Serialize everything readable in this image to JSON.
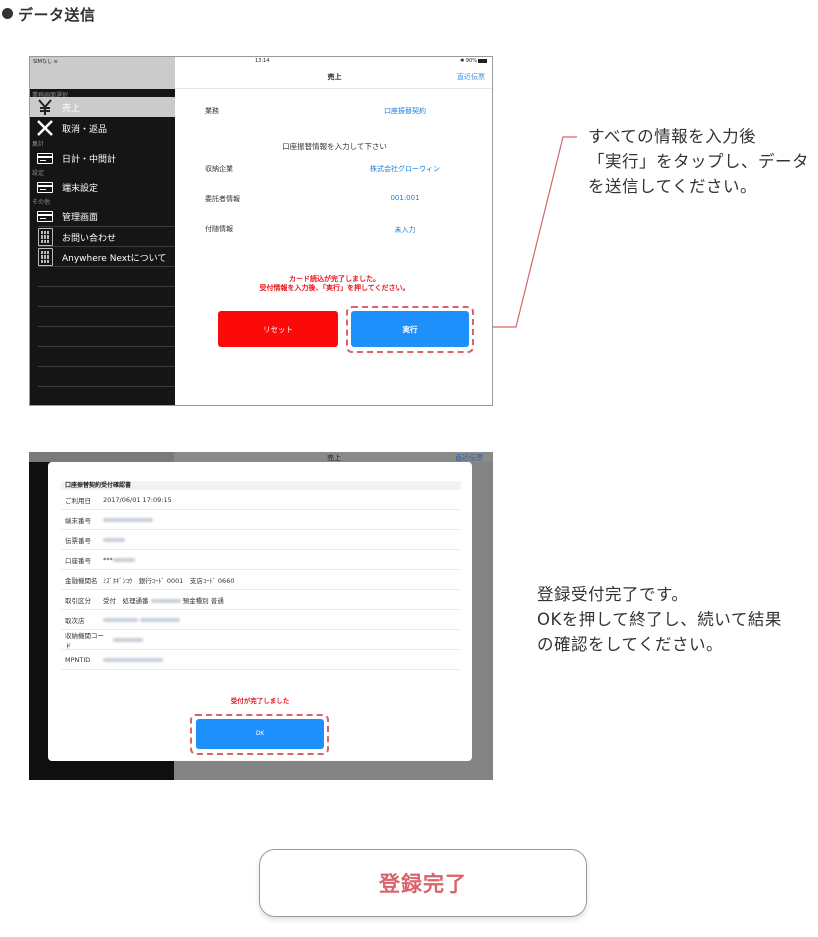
{
  "section_title": "データ送信",
  "screen1": {
    "statusbar": {
      "carrier": "SIMなし",
      "time": "13:14",
      "battery": "90%"
    },
    "sidebar": {
      "groups": [
        "業務画面選択",
        "集計",
        "設定",
        "その他"
      ],
      "items": [
        {
          "label": "売上",
          "icon": "yen-icon",
          "selected": true
        },
        {
          "label": "取消・返品",
          "icon": "x-icon",
          "selected": false
        },
        {
          "label": "日計・中間計",
          "icon": "card-icon",
          "selected": false
        },
        {
          "label": "端末設定",
          "icon": "card-icon",
          "selected": false
        },
        {
          "label": "管理画面",
          "icon": "card-icon",
          "selected": false
        },
        {
          "label": "お問い合わせ",
          "icon": "calculator-icon",
          "selected": false
        },
        {
          "label": "Anywhere Nextについて",
          "icon": "calculator-icon",
          "selected": false
        }
      ]
    },
    "navbar": {
      "title": "売上",
      "right_link": "直近伝票"
    },
    "form": {
      "business_label": "業務",
      "business_value": "口座振替契約",
      "instruction": "口座振替情報を入力して下さい",
      "rows": [
        {
          "label": "収納企業",
          "value": "株式会社グローウィン"
        },
        {
          "label": "委託者情報",
          "value": "001:001"
        },
        {
          "label": "付随情報",
          "value": "未入力"
        }
      ],
      "alert_line1": "カード読込が完了しました。",
      "alert_line2": "受付情報を入力後、「実行」を押してください。",
      "reset_button": "リセット",
      "execute_button": "実行"
    },
    "colors": {
      "reset": "#fc0a0a",
      "execute": "#1e90fb",
      "highlight": "#d9636b"
    }
  },
  "callout1": {
    "line1": "すべての情報を入力後",
    "line2": "「実行」をタップし、データ",
    "line3": "を送信してください。"
  },
  "screen2": {
    "navbar": {
      "title": "売上",
      "right_link": "直近伝票"
    },
    "modal": {
      "header": "口座振替契約受付確認書",
      "rows": [
        {
          "label": "ご利用日",
          "value": "2017/06/01 17:09:15"
        },
        {
          "label": "端末番号",
          "value": ""
        },
        {
          "label": "伝票番号",
          "value": ""
        },
        {
          "label": "口座番号",
          "value": "***"
        },
        {
          "label": "金融機関名",
          "value": "ﾐｽﾞﾎｷﾞﾝｺｳ　銀行ｺｰﾄﾞ 0001　支店ｺｰﾄﾞ 0660"
        },
        {
          "label": "取引区分",
          "value": "受付　処理通番",
          "value_suffix": "預金種別 普通"
        },
        {
          "label": "取次店",
          "value": ""
        },
        {
          "label": "収納機関コード",
          "value": ""
        },
        {
          "label": "MPNTID",
          "value": ""
        }
      ],
      "message": "受付が完了しました",
      "ok_button": "OK"
    }
  },
  "callout2": {
    "line1": "登録受付完了です。",
    "line2": "OKを押して終了し、続いて結果",
    "line3": "の確認をしてください。"
  },
  "complete_button": "登録完了"
}
